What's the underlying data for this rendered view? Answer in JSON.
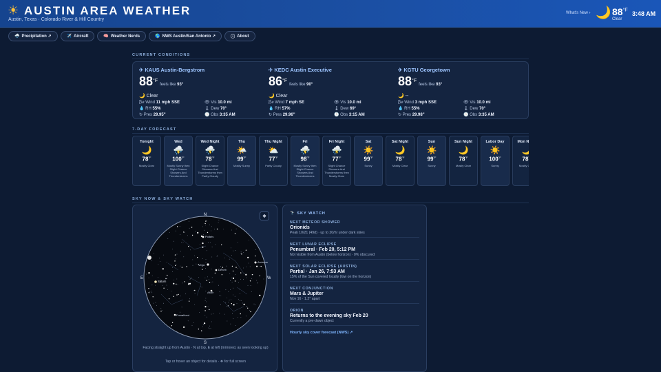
{
  "header": {
    "logo_icon": "sun-icon",
    "title": "AUSTIN AREA WEATHER",
    "subtitle": "Austin, Texas · Colorado River & Hill Country",
    "whats_new": "What's New ›",
    "current_icon": "moon-icon",
    "current_temp": "88",
    "current_unit": "°F",
    "current_condition": "Clear",
    "time": "3:48 AM"
  },
  "nav": [
    {
      "icon": "🌧️",
      "label": "Precipitation ↗"
    },
    {
      "icon": "✈️",
      "label": "Aircraft"
    },
    {
      "icon": "🧠",
      "label": "Weather Nerds"
    },
    {
      "icon": "🌎",
      "label": "NWS Austin/San Antonio ↗"
    },
    {
      "icon": "ⓘ",
      "label": "About"
    }
  ],
  "current_conditions": {
    "section_title": "CURRENT CONDITIONS",
    "stations": [
      {
        "name": "✈ KAUS Austin-Bergstrom",
        "temp": "88",
        "unit": "°F",
        "feels_prefix": "feels like",
        "feels": "93°",
        "cond_icon": "🌙",
        "condition": "Clear",
        "wind_label": "Wind",
        "wind": "11 mph SSE",
        "vis_label": "Vis",
        "vis": "10.0 mi",
        "rh_label": "RH",
        "rh": "55%",
        "dew_label": "Dew",
        "dew": "70°",
        "pres_label": "Pres",
        "pres": "29.95\"",
        "obs_label": "Obs",
        "obs": "3:35 AM"
      },
      {
        "name": "✈ KEDC Austin Executive",
        "temp": "86",
        "unit": "°F",
        "feels_prefix": "feels like",
        "feels": "90°",
        "cond_icon": "🌙",
        "condition": "Clear",
        "wind_label": "Wind",
        "wind": "7 mph SE",
        "vis_label": "Vis",
        "vis": "10.0 mi",
        "rh_label": "RH",
        "rh": "57%",
        "dew_label": "Dew",
        "dew": "69°",
        "pres_label": "Pres",
        "pres": "29.96\"",
        "obs_label": "Obs",
        "obs": "3:15 AM"
      },
      {
        "name": "✈ KGTU Georgetown",
        "temp": "88",
        "unit": "°F",
        "feels_prefix": "feels like",
        "feels": "93°",
        "cond_icon": "🌙",
        "condition": "--",
        "wind_label": "Wind",
        "wind": "3 mph SSE",
        "vis_label": "Vis",
        "vis": "10.0 mi",
        "rh_label": "RH",
        "rh": "55%",
        "dew_label": "Dew",
        "dew": "70°",
        "pres_label": "Pres",
        "pres": "29.98\"",
        "obs_label": "Obs",
        "obs": "3:35 AM"
      }
    ]
  },
  "forecast": {
    "section_title": "7-DAY FORECAST",
    "unit": "°F",
    "periods": [
      {
        "name": "Tonight",
        "icon": "🌙",
        "temp": "78",
        "desc": "Mostly Clear",
        "day": false
      },
      {
        "name": "Wed",
        "icon": "⛈️",
        "temp": "100",
        "desc": "Mostly Sunny then Slight Chance Showers And Thunderstorms",
        "day": true
      },
      {
        "name": "Wed Night",
        "icon": "⛈️",
        "temp": "78",
        "desc": "Slight Chance Showers And Thunderstorms then Partly Cloudy",
        "day": false
      },
      {
        "name": "Thu",
        "icon": "🌤️",
        "temp": "99",
        "desc": "Mostly Sunny",
        "day": true
      },
      {
        "name": "Thu Night",
        "icon": "⛅",
        "temp": "77",
        "desc": "Partly Cloudy",
        "day": false
      },
      {
        "name": "Fri",
        "icon": "⛈️",
        "temp": "98",
        "desc": "Mostly Sunny then Slight Chance Showers And Thunderstorms",
        "day": true
      },
      {
        "name": "Fri Night",
        "icon": "⛈️",
        "temp": "77",
        "desc": "Slight Chance Showers And Thunderstorms then Mostly Clear",
        "day": false
      },
      {
        "name": "Sat",
        "icon": "☀️",
        "temp": "99",
        "desc": "Sunny",
        "day": true
      },
      {
        "name": "Sat Night",
        "icon": "🌙",
        "temp": "78",
        "desc": "Mostly Clear",
        "day": false
      },
      {
        "name": "Sun",
        "icon": "☀️",
        "temp": "99",
        "desc": "Sunny",
        "day": true
      },
      {
        "name": "Sun Night",
        "icon": "🌙",
        "temp": "78",
        "desc": "Mostly Clear",
        "day": false
      },
      {
        "name": "Labor Day",
        "icon": "☀️",
        "temp": "100",
        "desc": "Sunny",
        "day": true
      },
      {
        "name": "Mon Night",
        "icon": "🌙",
        "temp": "78",
        "desc": "Mostly Clear",
        "day": false
      }
    ]
  },
  "sky": {
    "section_title": "SKY NOW & SKY WATCH",
    "fullscreen_icon": "❖",
    "compass": {
      "n": "N",
      "s": "S",
      "e": "E",
      "w": "W"
    },
    "objects": [
      "Polaris",
      "Vega",
      "Deneb",
      "Altair",
      "Saturn",
      "Fomalhaut",
      "Arcturus"
    ],
    "caption": "Facing straight up from Austin · N at top, E at left (mirrored, as seen looking up)",
    "hint": "Tap or hover an object for details · ❖ for full screen"
  },
  "sky_watch": {
    "title_icon": "🔭",
    "title": "SKY WATCH",
    "items": [
      {
        "label": "NEXT METEOR SHOWER",
        "value": "Orionids",
        "note": "Peak 10/21 (49d) · up to 20/hr under dark skies"
      },
      {
        "label": "NEXT LUNAR ECLIPSE",
        "value": "Penumbral · Feb 20, 5:12 PM",
        "note": "Not visible from Austin (below horizon) · 0% obscured"
      },
      {
        "label": "NEXT SOLAR ECLIPSE (AUSTIN)",
        "value": "Partial · Jan 26, 7:53 AM",
        "note": "15% of the Sun covered locally (low on the horizon)"
      },
      {
        "label": "NEXT CONJUNCTION",
        "value": "Mars & Jupiter",
        "note": "Nov 16 · 1.2° apart"
      },
      {
        "label": "ORION",
        "value": "Returns to the evening sky Feb 20",
        "note": "Currently a pre-dawn object"
      }
    ],
    "link": "Hourly sky cover forecast (NWS) ↗"
  }
}
